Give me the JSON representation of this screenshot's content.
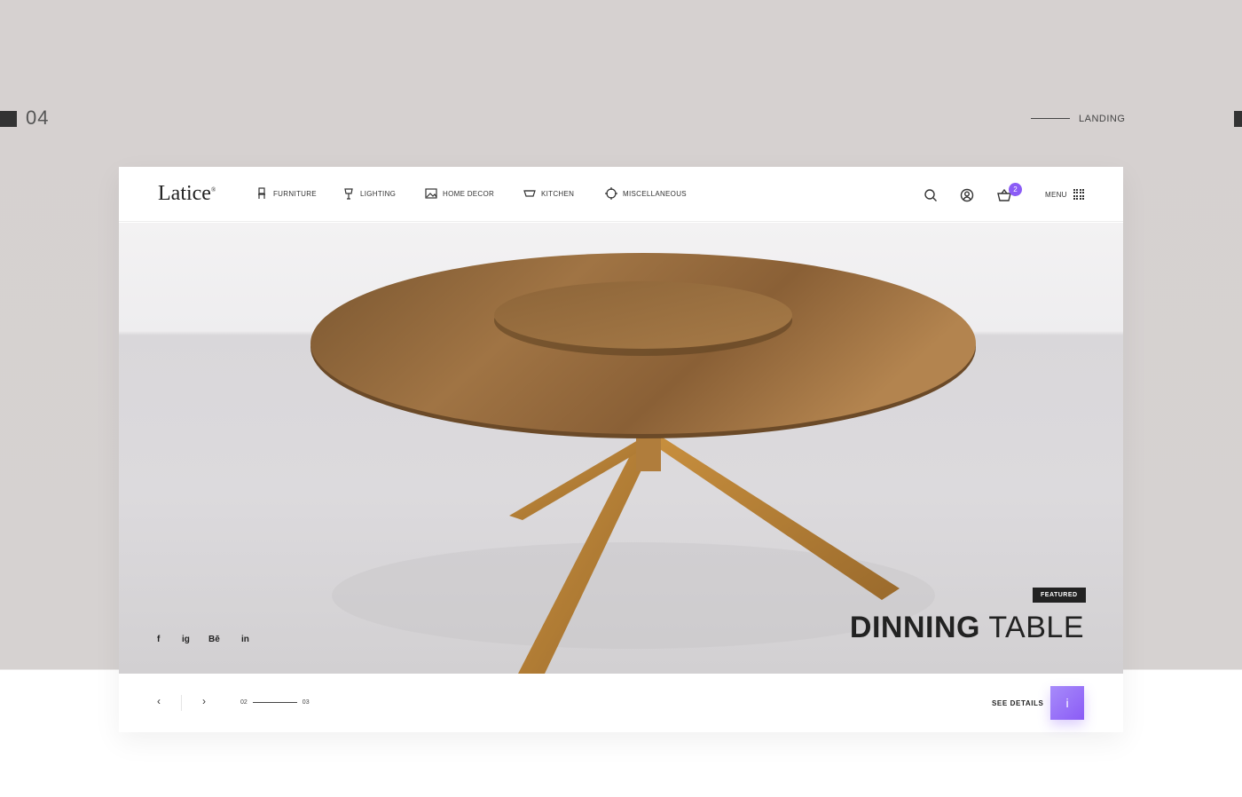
{
  "slide": {
    "number": "04",
    "section_label": "LANDING"
  },
  "header": {
    "logo": "Latice",
    "logo_mark": "®",
    "nav": [
      {
        "label": "FURNITURE",
        "icon": "chair-icon"
      },
      {
        "label": "LIGHTING",
        "icon": "lamp-icon"
      },
      {
        "label": "HOME DECOR",
        "icon": "picture-icon"
      },
      {
        "label": "KITCHEN",
        "icon": "bowl-icon"
      },
      {
        "label": "MISCELLANEOUS",
        "icon": "target-icon"
      }
    ],
    "cart_count": "2",
    "menu_label": "MENU"
  },
  "hero": {
    "badge": "FEATURED",
    "title_bold": "DINNING",
    "title_light": "TABLE",
    "social": [
      "f",
      "ig",
      "Bē",
      "in"
    ]
  },
  "footer": {
    "prev": "‹",
    "next": "›",
    "page_current": "02",
    "page_total": "03",
    "see_details": "SEE DETAILS",
    "info_label": "i"
  },
  "colors": {
    "accent": "#8b5cf6",
    "dark": "#222222",
    "background": "#d6d1d0"
  }
}
